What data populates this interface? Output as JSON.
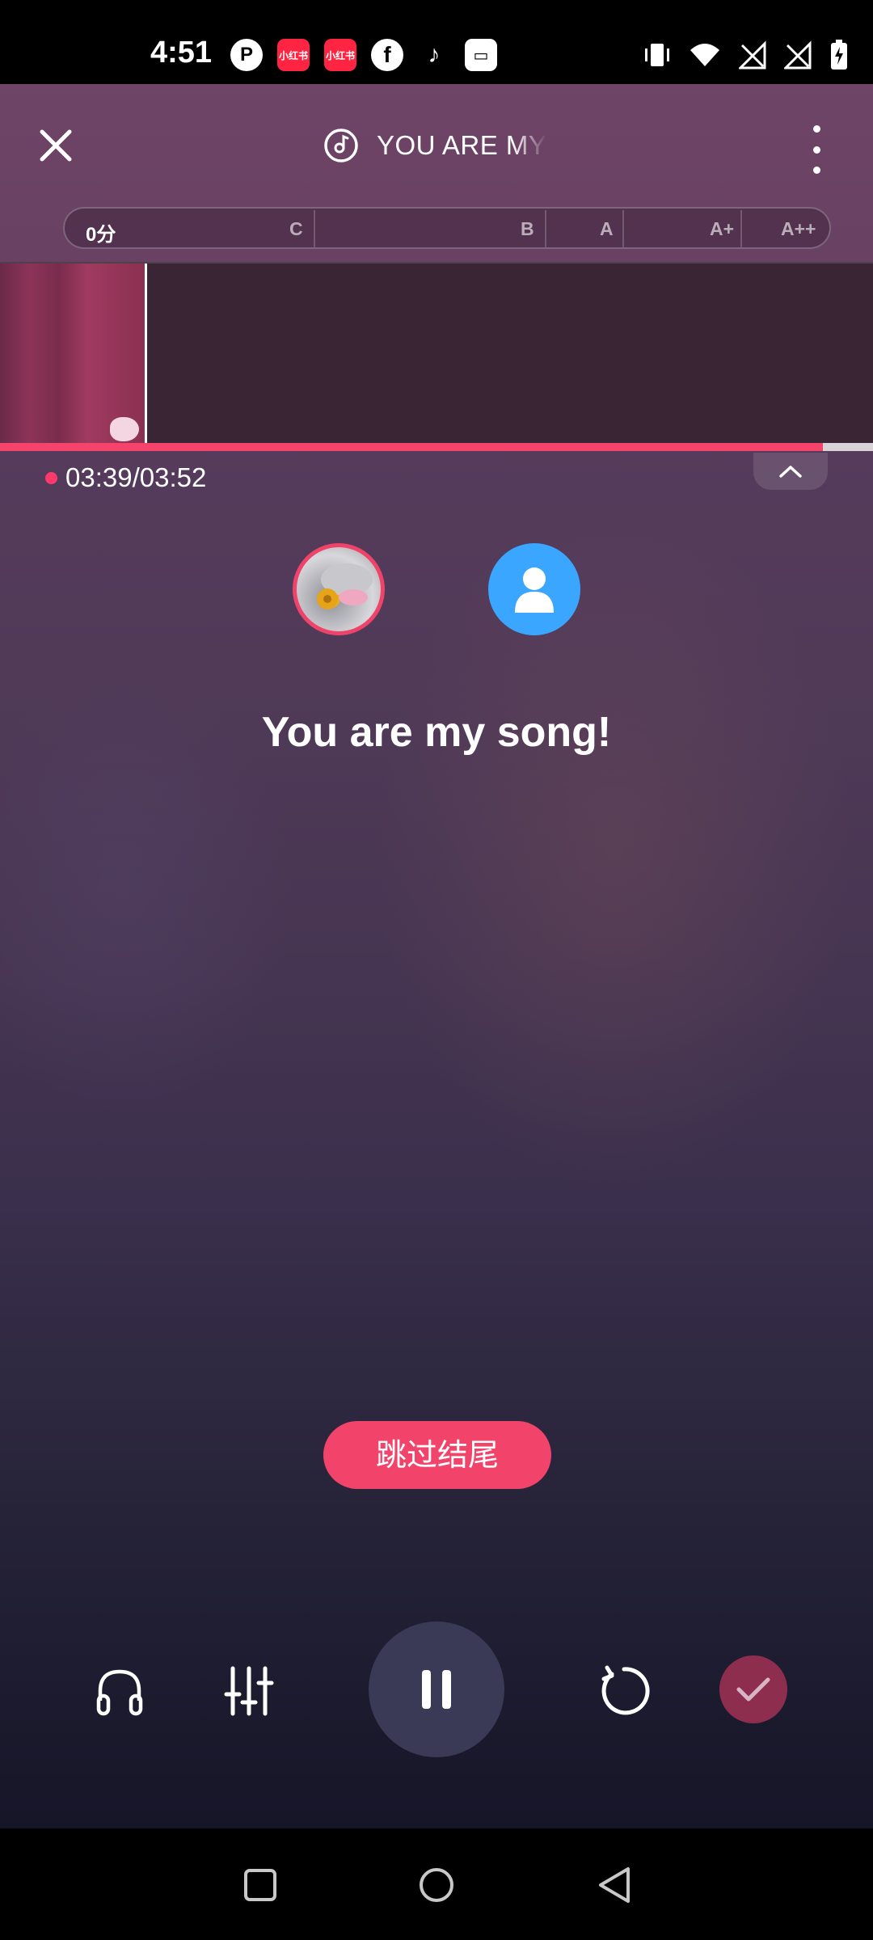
{
  "status_bar": {
    "time": "4:51",
    "app_icons": [
      "p-app-icon",
      "xiaohongshu-icon",
      "xiaohongshu-icon",
      "facebook-icon",
      "tiktok-icon",
      "box-app-icon"
    ],
    "xhs_label": "小红书",
    "right_icons": [
      "vibrate-icon",
      "wifi-icon",
      "no-signal-icon",
      "no-signal-icon",
      "battery-charging-icon"
    ]
  },
  "header": {
    "song_title": "YOU ARE MY SONG",
    "icons": {
      "close": "close-icon",
      "music_disc": "music-disc-icon",
      "more": "more-vertical-icon"
    }
  },
  "score_bar": {
    "score": "0分",
    "grades": [
      "C",
      "B",
      "A",
      "A+",
      "A++"
    ]
  },
  "playback": {
    "time": "03:39/03:52",
    "progress": 0.943
  },
  "singers": {
    "avatar_1": "user-avatar",
    "avatar_2": "default-user-icon"
  },
  "lyric": "You are my song!",
  "skip_button": "跳过结尾",
  "controls": {
    "icons": [
      "headphone-icon",
      "mixer-icon",
      "pause-icon",
      "retry-icon",
      "check-icon"
    ]
  },
  "nav_bar": {
    "icons": [
      "recents-square-icon",
      "home-circle-icon",
      "back-triangle-icon"
    ]
  },
  "colors": {
    "accent": "#f2436b",
    "pause_bg": "#3b3a56",
    "finish_bg": "#8e2e4e",
    "avatar_blue": "#3aa6ff"
  }
}
